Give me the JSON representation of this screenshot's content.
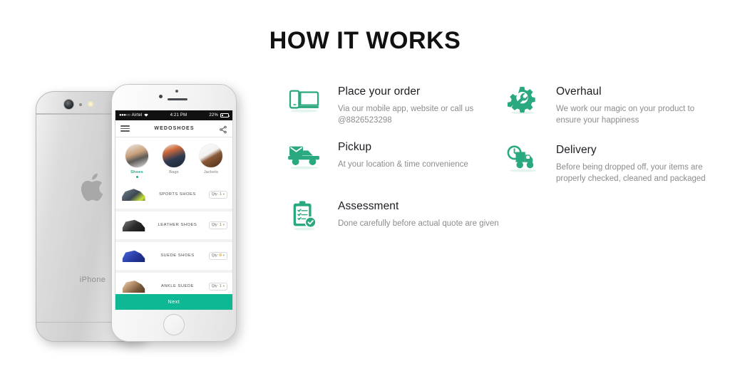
{
  "page": {
    "title": "HOW IT WORKS",
    "accent_green": "#0fb894",
    "icon_green": "#2aa87f",
    "title_color": "#111111",
    "desc_color": "#8c8c8c"
  },
  "phone": {
    "back_label": "iPhone",
    "status_bar": {
      "signal_dots": "●●●○○",
      "carrier": "Airtel",
      "time": "4:21 PM",
      "battery": "22%"
    },
    "app_bar": {
      "brand": "WEDOSHOES",
      "menu_icon": "hamburger-icon",
      "share_icon": "share-icon"
    },
    "categories": [
      {
        "label": "Shoes",
        "active": true
      },
      {
        "label": "Bags",
        "active": false
      },
      {
        "label": "Jackets",
        "active": false
      }
    ],
    "products": [
      {
        "name": "SPORTS SHOES",
        "qty_label": "Qty:",
        "qty": "1"
      },
      {
        "name": "LEATHER SHOES",
        "qty_label": "Qty:",
        "qty": "1"
      },
      {
        "name": "SUEDE SHOES",
        "qty_label": "Qty:",
        "qty": "0"
      },
      {
        "name": "ANKLE SUEDE",
        "qty_label": "Qty:",
        "qty": "1"
      }
    ],
    "next_button": "Next"
  },
  "features": [
    {
      "id": "place-your-order",
      "icon": "devices-icon",
      "title": "Place your order",
      "desc": "Via our mobile app, website or call us @8826523298"
    },
    {
      "id": "overhaul",
      "icon": "gear-wrench-icon",
      "title": "Overhaul",
      "desc": "We work our magic on your product to ensure your happiness"
    },
    {
      "id": "pickup",
      "icon": "pickup-truck-icon",
      "title": "Pickup",
      "desc": "At your location & time convenience"
    },
    {
      "id": "delivery",
      "icon": "delivery-truck-clock-icon",
      "title": "Delivery",
      "desc": "Before being dropped off, your items are properly checked, cleaned and packaged"
    },
    {
      "id": "assessment",
      "icon": "clipboard-check-icon",
      "title": "Assessment",
      "desc": "Done carefully before actual quote are given"
    }
  ]
}
